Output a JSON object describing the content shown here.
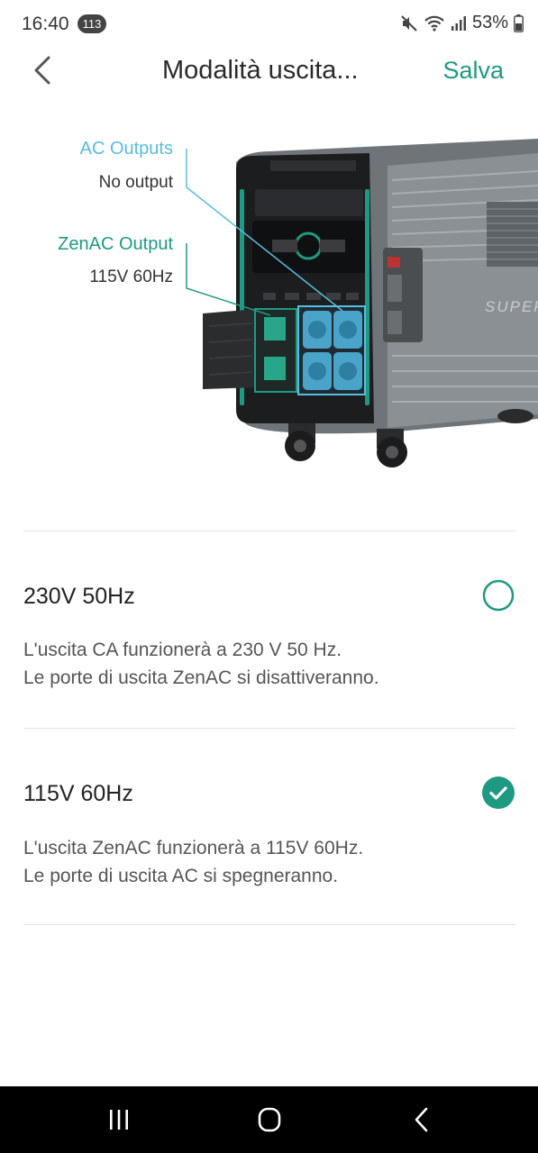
{
  "status_bar": {
    "time": "16:40",
    "notification_count": "113",
    "battery": "53%"
  },
  "header": {
    "title": "Modalità uscita...",
    "save_label": "Salva"
  },
  "illustration": {
    "ac_outputs_label": "AC Outputs",
    "ac_outputs_value": "No output",
    "zenac_output_label": "ZenAC Output",
    "zenac_output_value": "115V 60Hz",
    "device_brand_text": "SUPER"
  },
  "options": [
    {
      "title": "230V 50Hz",
      "desc_line1": "L'uscita CA funzionerà a 230 V 50 Hz.",
      "desc_line2": "Le porte di uscita ZenAC si disattiveranno.",
      "selected": false
    },
    {
      "title": "115V 60Hz",
      "desc_line1": "L'uscita ZenAC funzionerà a 115V 60Hz.",
      "desc_line2": "Le porte di uscita AC si spegneranno.",
      "selected": true
    }
  ],
  "colors": {
    "accent": "#1e9a82",
    "ac_blue": "#5bbbe0"
  },
  "nav": {
    "icons": [
      "recents-icon",
      "home-icon",
      "back-nav-icon"
    ]
  }
}
